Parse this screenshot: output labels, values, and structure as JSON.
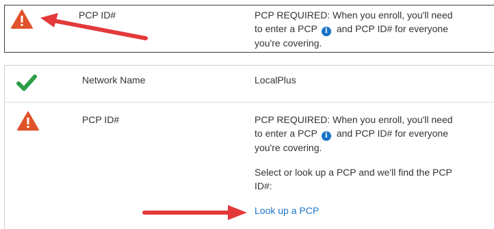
{
  "top_card": {
    "field_label": "PCP ID#",
    "message_part1": "PCP REQUIRED: When you enroll, you'll need",
    "message_part2": "to enter a PCP",
    "message_part3": "and PCP ID# for everyone",
    "message_part4": "you're covering."
  },
  "main_card": {
    "network_row": {
      "label": "Network Name",
      "value": "LocalPlus"
    },
    "pcp_row": {
      "label": "PCP ID#",
      "message_part1": "PCP REQUIRED: When you enroll, you'll need",
      "message_part2": "to enter a PCP",
      "message_part3": "and PCP ID# for everyone",
      "message_part4": "you're covering.",
      "instruction_line1": "Select or look up a PCP and we'll find the PCP",
      "instruction_line2": "ID#:",
      "lookup_link": "Look up a PCP"
    }
  },
  "icons": {
    "warning": "warning-triangle-icon",
    "check": "checkmark-icon",
    "info": "info-icon",
    "info_glyph": "i",
    "arrow": "red-arrow-annotation"
  },
  "colors": {
    "warning": "#e0522a",
    "check": "#2e9e47",
    "info": "#1a73c7",
    "link": "#1a73c7",
    "arrow": "#e3393a"
  }
}
